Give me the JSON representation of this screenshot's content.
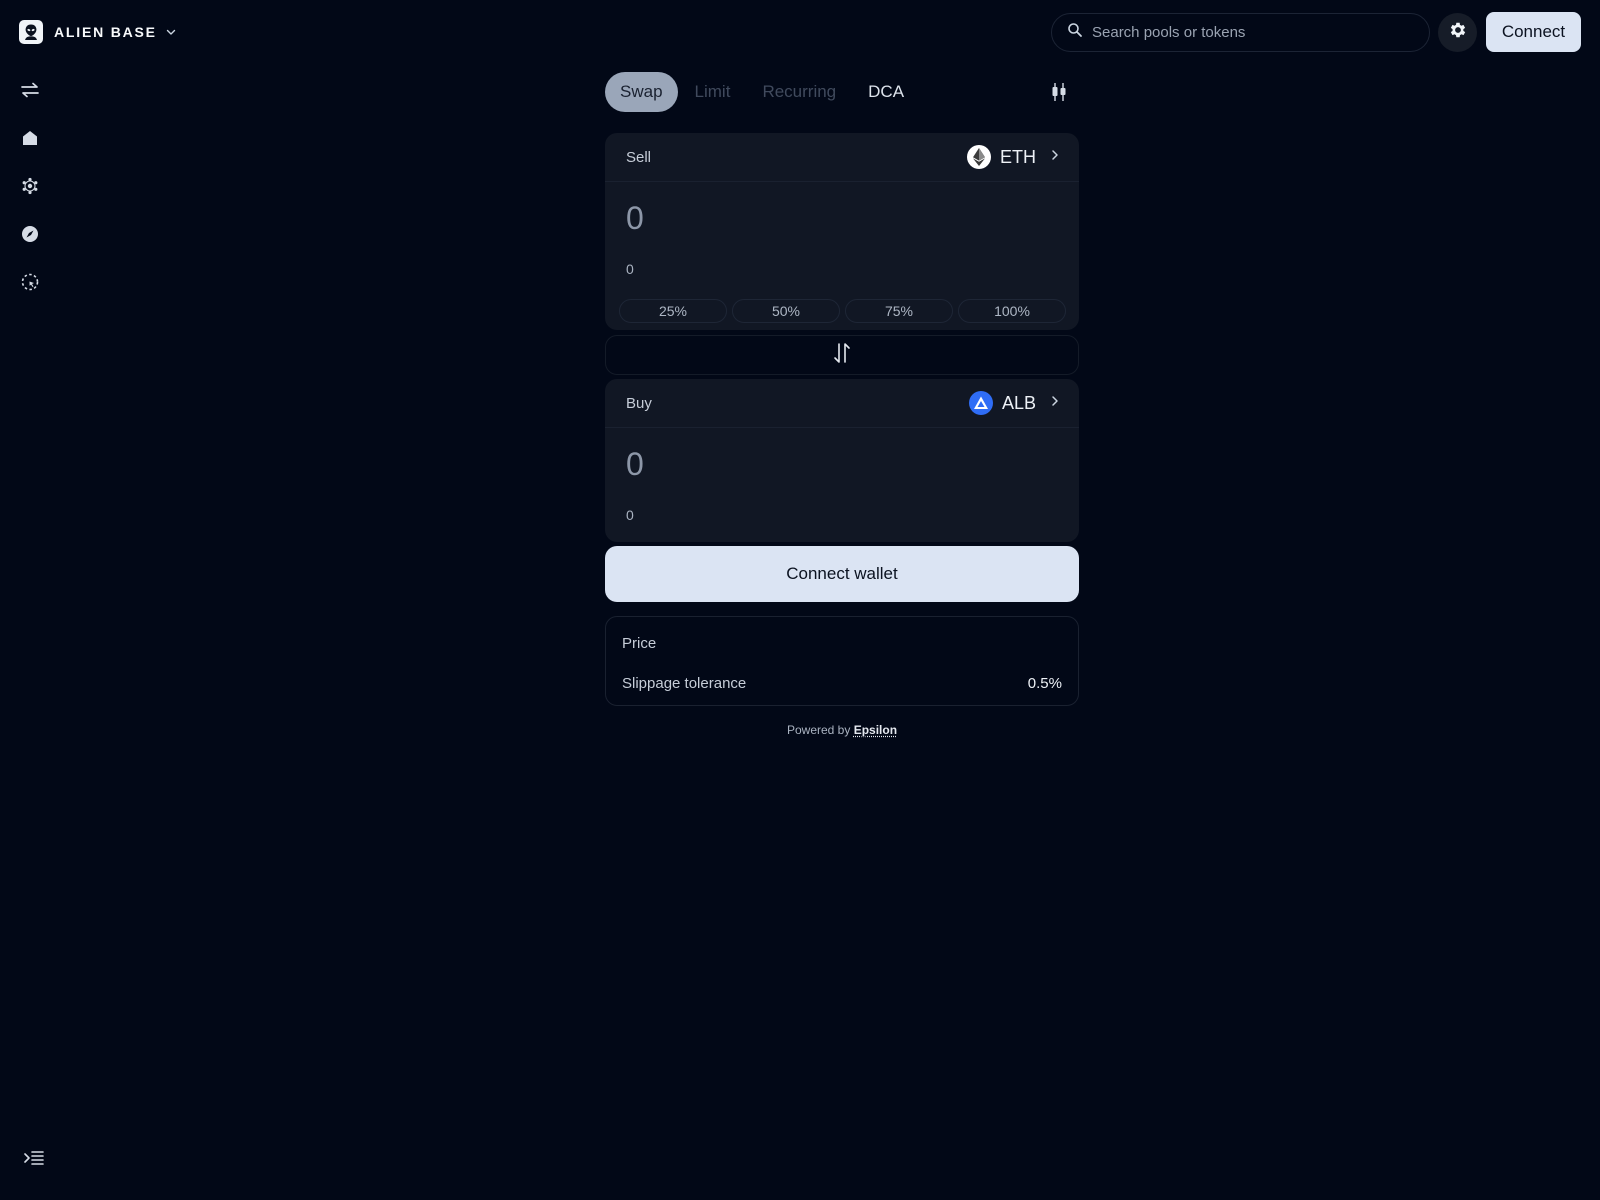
{
  "brand": {
    "name": "ALIEN BASE"
  },
  "header": {
    "search_placeholder": "Search pools or tokens",
    "connect_label": "Connect"
  },
  "sidebar": {
    "items": [
      {
        "icon": "swap-arrows-icon"
      },
      {
        "icon": "home-icon"
      },
      {
        "icon": "atom-icon"
      },
      {
        "icon": "compass-icon"
      },
      {
        "icon": "dashed-circle-icon"
      }
    ]
  },
  "swap": {
    "tabs": [
      {
        "label": "Swap",
        "state": "active"
      },
      {
        "label": "Limit",
        "state": "disabled"
      },
      {
        "label": "Recurring",
        "state": "disabled"
      },
      {
        "label": "DCA",
        "state": "normal"
      }
    ],
    "sell": {
      "label": "Sell",
      "token": "ETH",
      "amount": "0",
      "usd_value": "0",
      "percent_buttons": [
        "25%",
        "50%",
        "75%",
        "100%"
      ]
    },
    "buy": {
      "label": "Buy",
      "token": "ALB",
      "amount": "0",
      "usd_value": "0"
    },
    "connect_wallet_label": "Connect wallet",
    "info": {
      "price_label": "Price",
      "slippage_label": "Slippage tolerance",
      "slippage_value": "0.5%"
    },
    "powered_by_prefix": "Powered by",
    "powered_by_name": "Epsilon"
  },
  "colors": {
    "background": "#020817",
    "card": "#111724",
    "accent_button": "#dbe4f3",
    "alb_blue": "#2f6df6"
  }
}
